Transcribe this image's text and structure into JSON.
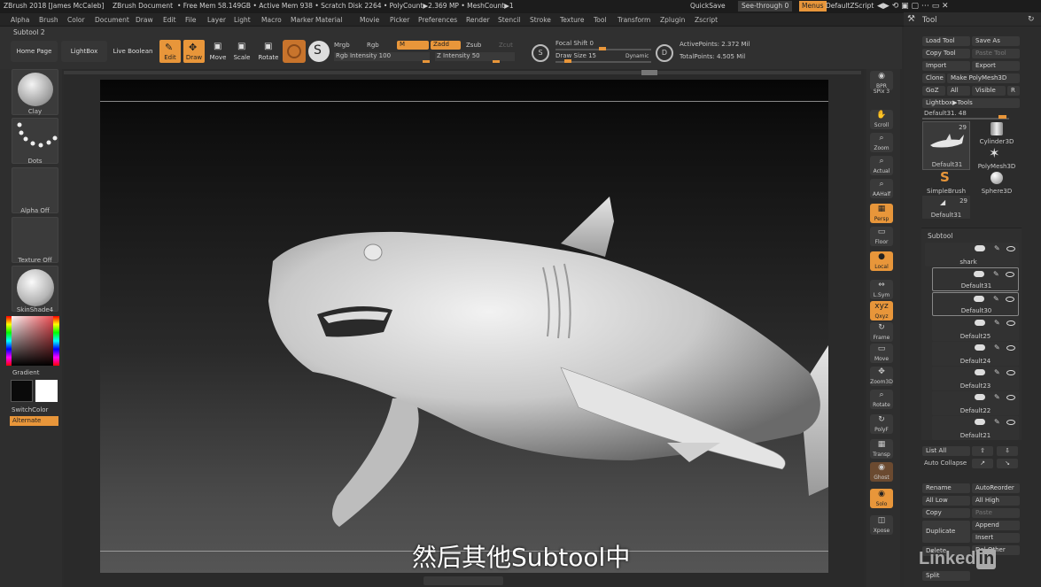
{
  "titlebar": {
    "app": "ZBrush 2018 [James McCaleb]",
    "doc": "ZBrush Document",
    "freemem": "• Free Mem 58.149GB • Active Mem 938 • Scratch Disk 2264 • PolyCount▶2.369 MP • MeshCount▶1",
    "quicksave": "QuickSave",
    "seethrough": "See-through  0",
    "menus": "Menus",
    "script": "DefaultZScript"
  },
  "menubar": [
    "Alpha",
    "Brush",
    "Color",
    "Document",
    "Draw",
    "Edit",
    "File",
    "Layer",
    "Light",
    "Macro",
    "Marker",
    "Material",
    "Movie",
    "Picker",
    "Preferences",
    "Render",
    "Stencil",
    "Stroke",
    "Texture",
    "Tool",
    "Transform",
    "Zplugin",
    "Zscript"
  ],
  "subtool_label": "Subtool 2",
  "toolbar": {
    "home": "Home Page",
    "lightbox": "LightBox",
    "liveboolean": "Live Boolean",
    "edit": "Edit",
    "draw": "Draw",
    "move": "Move",
    "scale": "Scale",
    "rotate": "Rotate",
    "mrgb": "Mrgb",
    "rgb": "Rgb",
    "m": "M",
    "zadd": "Zadd",
    "zsub": "Zsub",
    "zcut": "Zcut",
    "rgb_intensity": "Rgb Intensity 100",
    "z_intensity": "Z Intensity 50",
    "focal_shift": "Focal Shift 0",
    "draw_size": "Draw Size 15",
    "dynamic": "Dynamic",
    "active_points": "ActivePoints: 2.372 Mil",
    "total_points": "TotalPoints: 4.505 Mil"
  },
  "leftshelf": {
    "clay": "Clay",
    "dots": "Dots",
    "alpha": "Alpha Off",
    "texture": "Texture Off",
    "material": "SkinShade4",
    "gradient": "Gradient",
    "switchcolor": "SwitchColor",
    "alternate": "Alternate"
  },
  "rightstrip": [
    "BPR",
    "SPix 3",
    "Scroll",
    "Zoom",
    "Actual",
    "AAHalf",
    "Persp",
    "Floor",
    "Local",
    "L.Sym",
    "Qxyz",
    "Frame",
    "Move",
    "Zoom3D",
    "Rotate",
    "PolyF",
    "Transp",
    "Ghost",
    "Solo",
    "Xpose"
  ],
  "tool": {
    "title": "Tool",
    "load": "Load Tool",
    "saveas": "Save As",
    "copy": "Copy Tool",
    "paste": "Paste Tool",
    "import": "Import",
    "export": "Export",
    "clone": "Clone",
    "makepoly": "Make PolyMesh3D",
    "goz": "GoZ",
    "all": "All",
    "visible": "Visible",
    "r": "R",
    "lightbox_tools": "Lightbox▶Tools",
    "default_slider": "Default31. 48",
    "thumbs": [
      {
        "name": "Default31",
        "count": "29"
      },
      {
        "name": "Cylinder3D"
      },
      {
        "name": "PolyMesh3D"
      },
      {
        "name": "SimpleBrush"
      },
      {
        "name": "Sphere3D"
      },
      {
        "name": "Default31",
        "count": "29"
      }
    ]
  },
  "subtool": {
    "header": "Subtool",
    "items": [
      "shark",
      "Default31",
      "Default30",
      "Default25",
      "Default24",
      "Default23",
      "Default22",
      "Default21"
    ],
    "listall": "List All",
    "autocollapse": "Auto Collapse",
    "rename": "Rename",
    "autoreorder": "AutoReorder",
    "alllow": "All Low",
    "allhigh": "All High",
    "copy": "Copy",
    "paste": "Paste",
    "duplicate": "Duplicate",
    "append": "Append",
    "insert": "Insert",
    "delother": "Del Other",
    "split": "Split",
    "delete": "Delete"
  },
  "subtitle": "然后其他Subtool中",
  "watermark": "Linked",
  "watermark_in": "in",
  "colors": {
    "accent": "#e8963a",
    "bg": "#2b2b2b",
    "canvas_top": "#060606",
    "canvas_bottom": "#555555"
  }
}
